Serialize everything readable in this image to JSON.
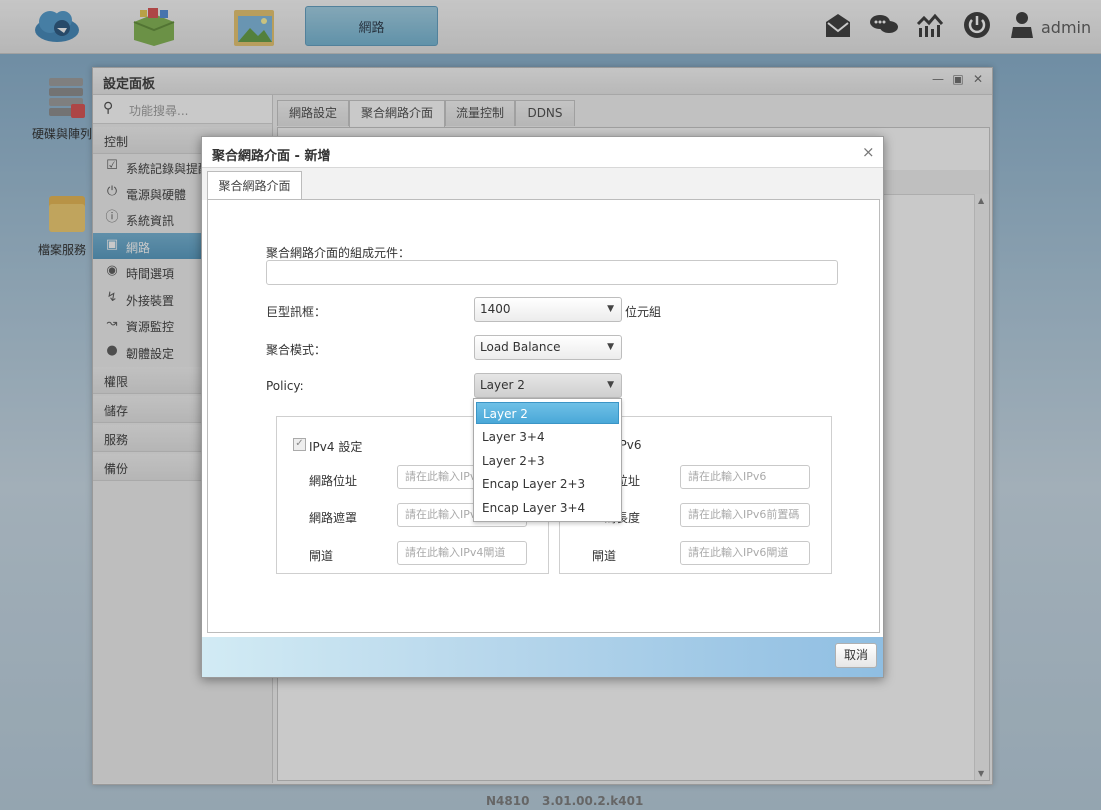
{
  "topbar": {
    "active_tab": "網路",
    "user": "admin"
  },
  "desktop": {
    "icon1": "硬碟與陣列",
    "icon2": "檔案服務"
  },
  "panel": {
    "title": "設定面板",
    "search_placeholder": "功能搜尋...",
    "sections": {
      "control": "控制",
      "permission": "權限",
      "storage": "儲存",
      "service": "服務",
      "backup": "備份"
    },
    "items": [
      {
        "label": "系統記錄與提醒",
        "icon": "clipboard-icon"
      },
      {
        "label": "電源與硬體",
        "icon": "power-icon"
      },
      {
        "label": "系統資訊",
        "icon": "info-icon"
      },
      {
        "label": "網路",
        "icon": "network-icon"
      },
      {
        "label": "時間選項",
        "icon": "globe-icon"
      },
      {
        "label": "外接裝置",
        "icon": "usb-icon"
      },
      {
        "label": "資源監控",
        "icon": "chart-icon"
      },
      {
        "label": "韌體設定",
        "icon": "fw-icon"
      }
    ],
    "tabs": [
      "網路設定",
      "聚合網路介面",
      "流量控制",
      "DDNS"
    ],
    "version": "N4810   3.01.00.2.k401"
  },
  "dialog": {
    "title": "聚合網路介面 - 新增",
    "tab": "聚合網路介面",
    "members_label": "聚合網路介面的組成元件：",
    "jumbo_label": "巨型訊框：",
    "jumbo_value": "1400",
    "jumbo_unit": "位元組",
    "mode_label": "聚合模式：",
    "mode_value": "Load Balance",
    "policy_label": "Policy:",
    "policy_value": "Layer 2",
    "policy_options": [
      "Layer 2",
      "Layer 3+4",
      "Layer 2+3",
      "Encap Layer 2+3",
      "Encap Layer 3+4"
    ],
    "ipv4": {
      "label": "IPv4 設定",
      "address_label": "網路位址",
      "address_placeholder": "請在此輸入IPv4",
      "mask_label": "網路遮罩",
      "mask_placeholder": "請在此輸入IPv4",
      "gateway_label": "閘道",
      "gateway_placeholder": "請在此輸入IPv4閘道"
    },
    "ipv6": {
      "label": "IPv6",
      "address_label": "位址",
      "address_placeholder": "請在此輸入IPv6",
      "prefix_label": "碼長度",
      "prefix_placeholder": "請在此輸入IPv6前置碼",
      "gateway_label": "閘道",
      "gateway_placeholder": "請在此輸入IPv6閘道"
    },
    "cancel": "取消"
  }
}
